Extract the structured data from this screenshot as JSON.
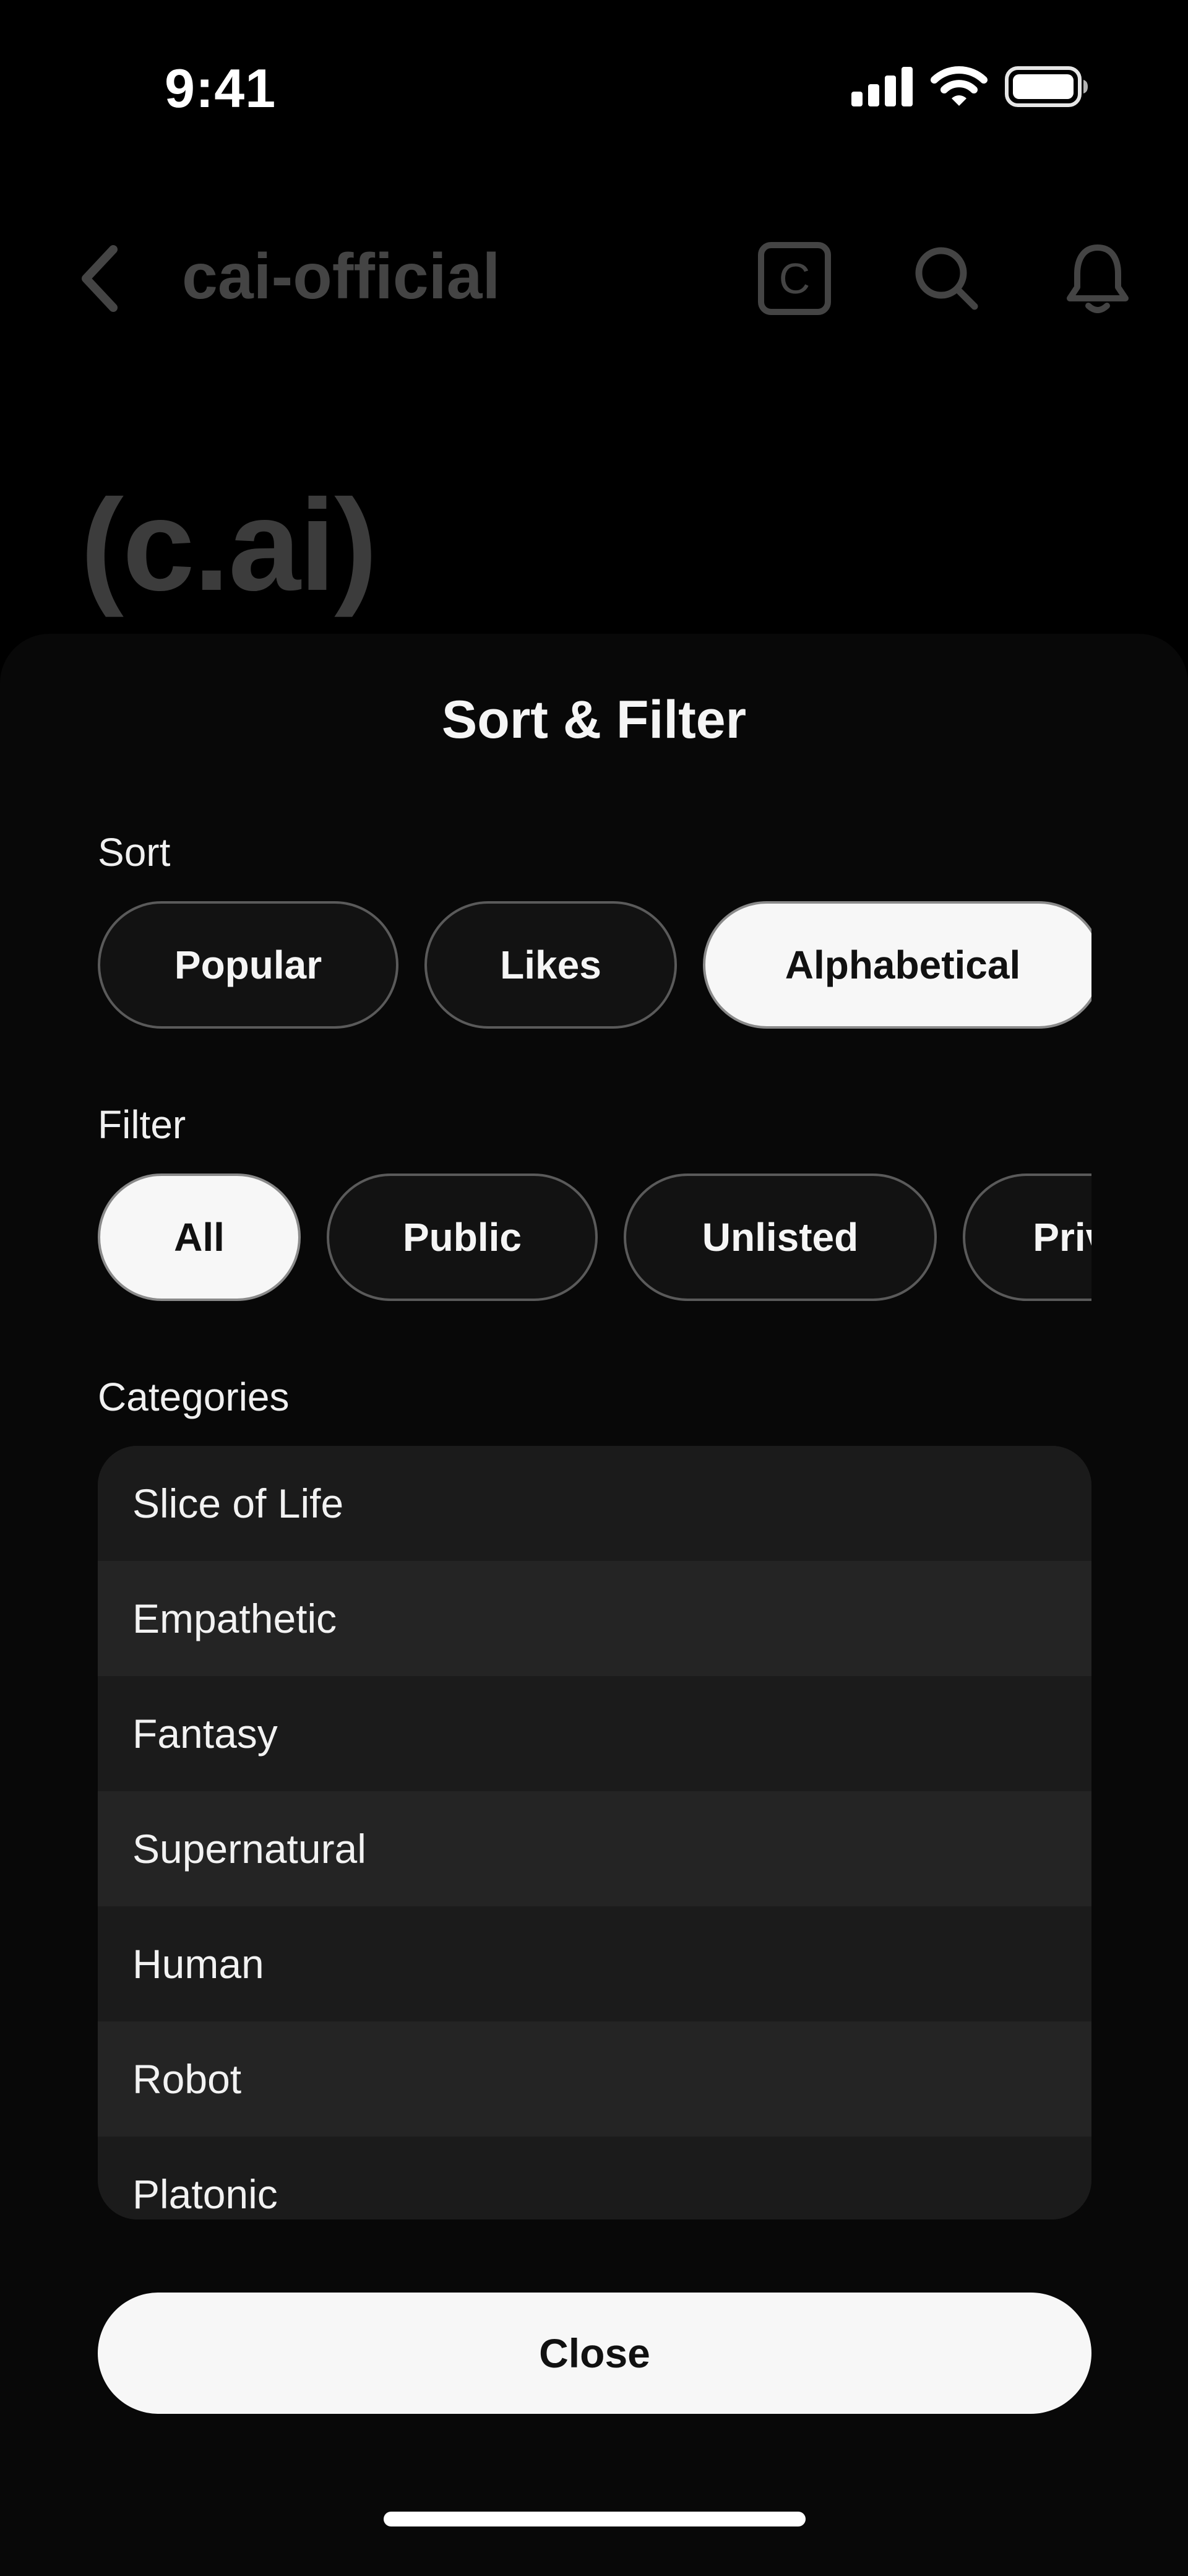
{
  "status_bar": {
    "time": "9:41"
  },
  "header": {
    "handle": "cai-official",
    "badge_letter": "C"
  },
  "profile": {
    "name": "(c.ai)"
  },
  "sheet": {
    "title": "Sort & Filter",
    "sort": {
      "label": "Sort",
      "options": [
        {
          "label": "Popular",
          "selected": false
        },
        {
          "label": "Likes",
          "selected": false
        },
        {
          "label": "Alphabetical",
          "selected": true
        }
      ]
    },
    "filter": {
      "label": "Filter",
      "options": [
        {
          "label": "All",
          "selected": true
        },
        {
          "label": "Public",
          "selected": false
        },
        {
          "label": "Unlisted",
          "selected": false
        },
        {
          "label": "Private",
          "selected": false
        }
      ]
    },
    "categories": {
      "label": "Categories",
      "items": [
        "Slice of Life",
        "Empathetic",
        "Fantasy",
        "Supernatural",
        "Human",
        "Robot",
        "Platonic"
      ]
    },
    "close_label": "Close"
  },
  "icons": {
    "back": "chevron-left-icon",
    "badge": "c-badge-icon",
    "search": "search-icon",
    "notifications": "bell-icon",
    "signal": "cellular-signal-icon",
    "wifi": "wifi-icon",
    "battery": "battery-icon"
  },
  "colors": {
    "background": "#000000",
    "sheet": "#080808",
    "chip_active_bg": "#f7f7f7",
    "chip_inactive_bg": "#121212",
    "dim_text": "#444444"
  }
}
